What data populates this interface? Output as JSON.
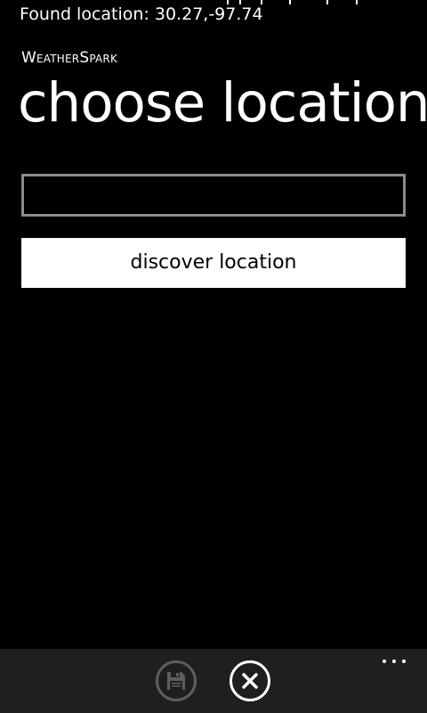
{
  "status": {
    "location_text": "Found location: 30.27,-97.74"
  },
  "header": {
    "app_name": "WeatherSpark",
    "page_title": "choose location"
  },
  "form": {
    "location_input_value": "",
    "discover_button_label": "discover location"
  },
  "app_bar": {
    "buttons": [
      {
        "icon": "save-icon",
        "enabled": false
      },
      {
        "icon": "close-icon",
        "enabled": true
      }
    ],
    "more_icon": "ellipsis-icon"
  },
  "colors": {
    "background": "#000000",
    "text": "#ffffff",
    "input_border": "#8c8c8c",
    "button_bg": "#ffffff",
    "button_text": "#000000",
    "app_bar_bg": "#1f1f1f",
    "disabled_icon": "#5e5e5e"
  }
}
